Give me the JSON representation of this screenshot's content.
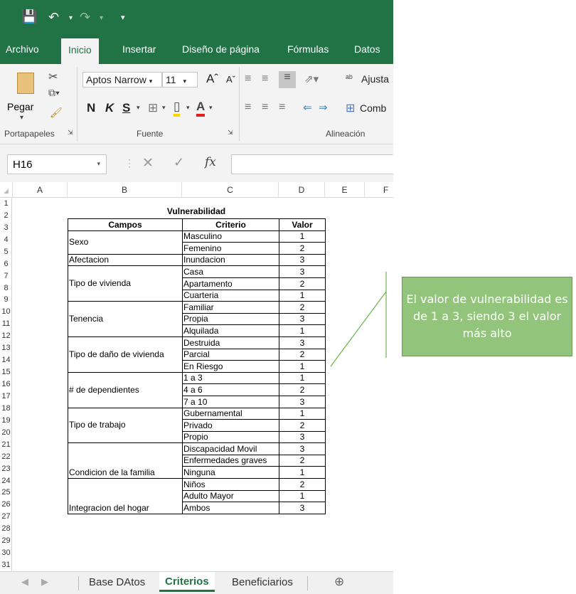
{
  "ribbon_tabs": [
    "Archivo",
    "Inicio",
    "Insertar",
    "Diseño de página",
    "Fórmulas",
    "Datos"
  ],
  "active_tab": "Inicio",
  "clipboard": {
    "paste_label": "Pegar",
    "group_label": "Portapapeles"
  },
  "font": {
    "name": "Aptos Narrow",
    "size": "11",
    "group_label": "Fuente",
    "bold": "N",
    "italic": "K",
    "underline": "S"
  },
  "alignment": {
    "wrap_label": "Ajusta",
    "merge_label": "Comb",
    "group_label": "Alineación"
  },
  "name_box": "H16",
  "formula_bar": {
    "fx_label": "fx",
    "content": ""
  },
  "columns": [
    "A",
    "B",
    "C",
    "D",
    "E",
    "F"
  ],
  "rows": [
    "1",
    "2",
    "3",
    "4",
    "5",
    "6",
    "7",
    "8",
    "9",
    "10",
    "11",
    "12",
    "13",
    "14",
    "15",
    "16",
    "17",
    "18",
    "19",
    "20",
    "21",
    "22",
    "23",
    "24",
    "25",
    "26",
    "27",
    "28",
    "29",
    "30",
    "31"
  ],
  "table": {
    "title": "Vulnerabilidad",
    "headers": [
      "Campos",
      "Criterio",
      "Valor"
    ],
    "groups": [
      {
        "campo": "Sexo",
        "items": [
          [
            "Masculino",
            "1"
          ],
          [
            "Femenino",
            "2"
          ]
        ]
      },
      {
        "campo": "Afectacion",
        "items": [
          [
            "Inundacion",
            "3"
          ]
        ]
      },
      {
        "campo": "Tipo de vivienda",
        "items": [
          [
            "Casa",
            "3"
          ],
          [
            "Apartamento",
            "2"
          ],
          [
            "Cuarteria",
            "1"
          ]
        ]
      },
      {
        "campo": "Tenencia",
        "items": [
          [
            "Familiar",
            "2"
          ],
          [
            "Propia",
            "3"
          ],
          [
            "Alquilada",
            "1"
          ]
        ]
      },
      {
        "campo": "Tipo de daño de vivienda",
        "items": [
          [
            "Destruida",
            "3"
          ],
          [
            "Parcial",
            "2"
          ],
          [
            "En Riesgo",
            "1"
          ]
        ]
      },
      {
        "campo": "# de dependientes",
        "items": [
          [
            "1 a 3",
            "1"
          ],
          [
            "4 a 6",
            "2"
          ],
          [
            "7 a 10",
            "3"
          ]
        ]
      },
      {
        "campo": "Tipo de trabajo",
        "items": [
          [
            "Gubernamental",
            "1"
          ],
          [
            "Privado",
            "2"
          ],
          [
            "Propio",
            "3"
          ]
        ]
      },
      {
        "campo": "Condicion de la familia",
        "items": [
          [
            "Discapacidad Movil",
            "3"
          ],
          [
            "Enfermedades graves",
            "2"
          ],
          [
            "Ninguna",
            "1"
          ]
        ]
      },
      {
        "campo": "Integracion del hogar",
        "items": [
          [
            "Niños",
            "2"
          ],
          [
            "Adulto Mayor",
            "1"
          ],
          [
            "Ambos",
            "3"
          ]
        ]
      }
    ]
  },
  "sheet_tabs": [
    "Base DAtos",
    "Criterios",
    "Beneficiarios"
  ],
  "active_sheet": "Criterios",
  "callout_text": "El valor de vulnerabilidad es de 1 a 3, siendo 3 el valor más alto",
  "colors": {
    "excel_green": "#217346",
    "callout_fill": "#92c47c"
  }
}
